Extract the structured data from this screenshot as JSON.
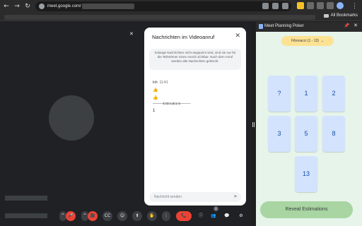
{
  "browser": {
    "back": "←",
    "forward": "→",
    "reload": "↻",
    "url": "meet.google.com/",
    "more": "⋮",
    "all_bookmarks": "All Bookmarks"
  },
  "meet": {
    "chat": {
      "title": "Nachrichten im Videoanruf",
      "close": "✕",
      "info": "Solange Nachrichten nicht angepinnt sind, sind sie nur für die Teilnehmer eines Anrufs sichtbar. Nach dem Anruf werden alle Nachrichten gelöscht.",
      "sender": "Ich",
      "time": "11:41",
      "messages": [
        "👍",
        "👍",
        "———Estimations———",
        "1"
      ],
      "input_placeholder": "Nachricht senden",
      "send_icon": "➤"
    },
    "controls": {
      "mic": "🎤",
      "camera": "🎥",
      "captions": "CC",
      "emoji": "☺",
      "present": "⬆",
      "raise_hand": "✋",
      "more": "⋮",
      "leave": "📞",
      "info": "ⓘ",
      "people": "👥",
      "people_count": "1",
      "chat": "💬",
      "activities": "⚙"
    }
  },
  "side_panel": {
    "title": "Meet Planning Poker",
    "pin": "📌",
    "close": "✕",
    "deck_select": "Fibonacci (1 - 13)",
    "cards": [
      "?",
      "1",
      "2",
      "3",
      "5",
      "8",
      "13"
    ],
    "reveal_label": "Reveal Estimations"
  },
  "colors": {
    "accent_green": "#a8d5a2",
    "card_blue": "#d3e3fd",
    "leave_red": "#ea4335"
  }
}
